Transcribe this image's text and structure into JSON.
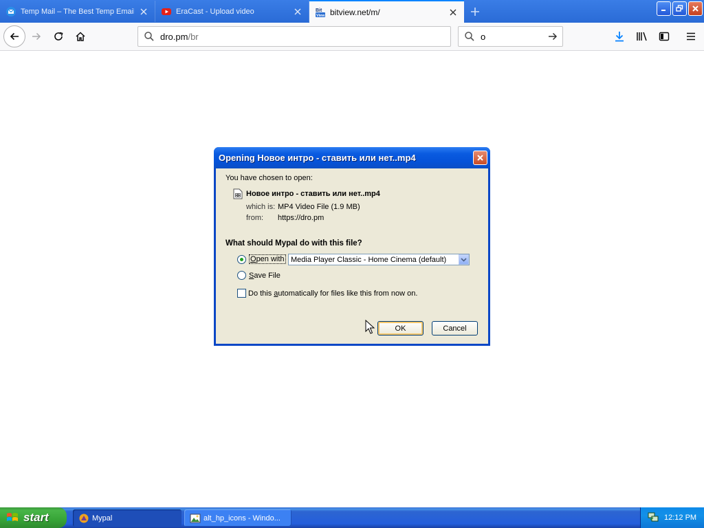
{
  "browser": {
    "tabs": [
      {
        "title": "Temp Mail – The Best Temp Email",
        "icon": "temp-mail-favicon",
        "state": "inactive"
      },
      {
        "title": "EraCast - Upload video",
        "icon": "eracast-youtube-favicon",
        "state": "inactive"
      },
      {
        "title": "bitview.net/m/",
        "icon": "bitview-favicon",
        "state": "active"
      }
    ],
    "bitview_icon_text": {
      "top": "Bit",
      "bottom": "View"
    },
    "url": {
      "main": "dro.pm",
      "path": "/br"
    },
    "search_value": "o"
  },
  "dialog": {
    "title": "Opening Новое интро - ставить или нет..mp4",
    "chosen_label": "You have chosen to open:",
    "file_name": "Новое интро - ставить или нет..mp4",
    "which_is_label": "which is:",
    "which_is_value": "MP4 Video File (1.9 MB)",
    "from_label": "from:",
    "from_value": "https://dro.pm",
    "question": "What should Mypal do with this file?",
    "open_with": {
      "accel": "O",
      "rest": "pen with",
      "selected": true
    },
    "app_select_value": "Media Player Classic - Home Cinema (default)",
    "save_file": {
      "accel": "S",
      "rest": "ave File",
      "selected": false
    },
    "auto_checkbox": {
      "pre": "Do this ",
      "accel": "a",
      "post": "utomatically for files like this from now on.",
      "checked": false
    },
    "ok_label": "OK",
    "cancel_label": "Cancel"
  },
  "taskbar": {
    "start_label": "start",
    "tasks": [
      {
        "label": "Mypal",
        "icon": "mypal-icon",
        "active": true
      },
      {
        "label": "alt_hp_icons - Windo...",
        "icon": "image-file-icon",
        "active": false
      }
    ],
    "clock": "12:12 PM"
  },
  "colors": {
    "xp_blue": "#0a47c6",
    "dialog_bg": "#ece9d8",
    "firefox_accent": "#0a84ff",
    "start_green": "#3c9a3c"
  }
}
